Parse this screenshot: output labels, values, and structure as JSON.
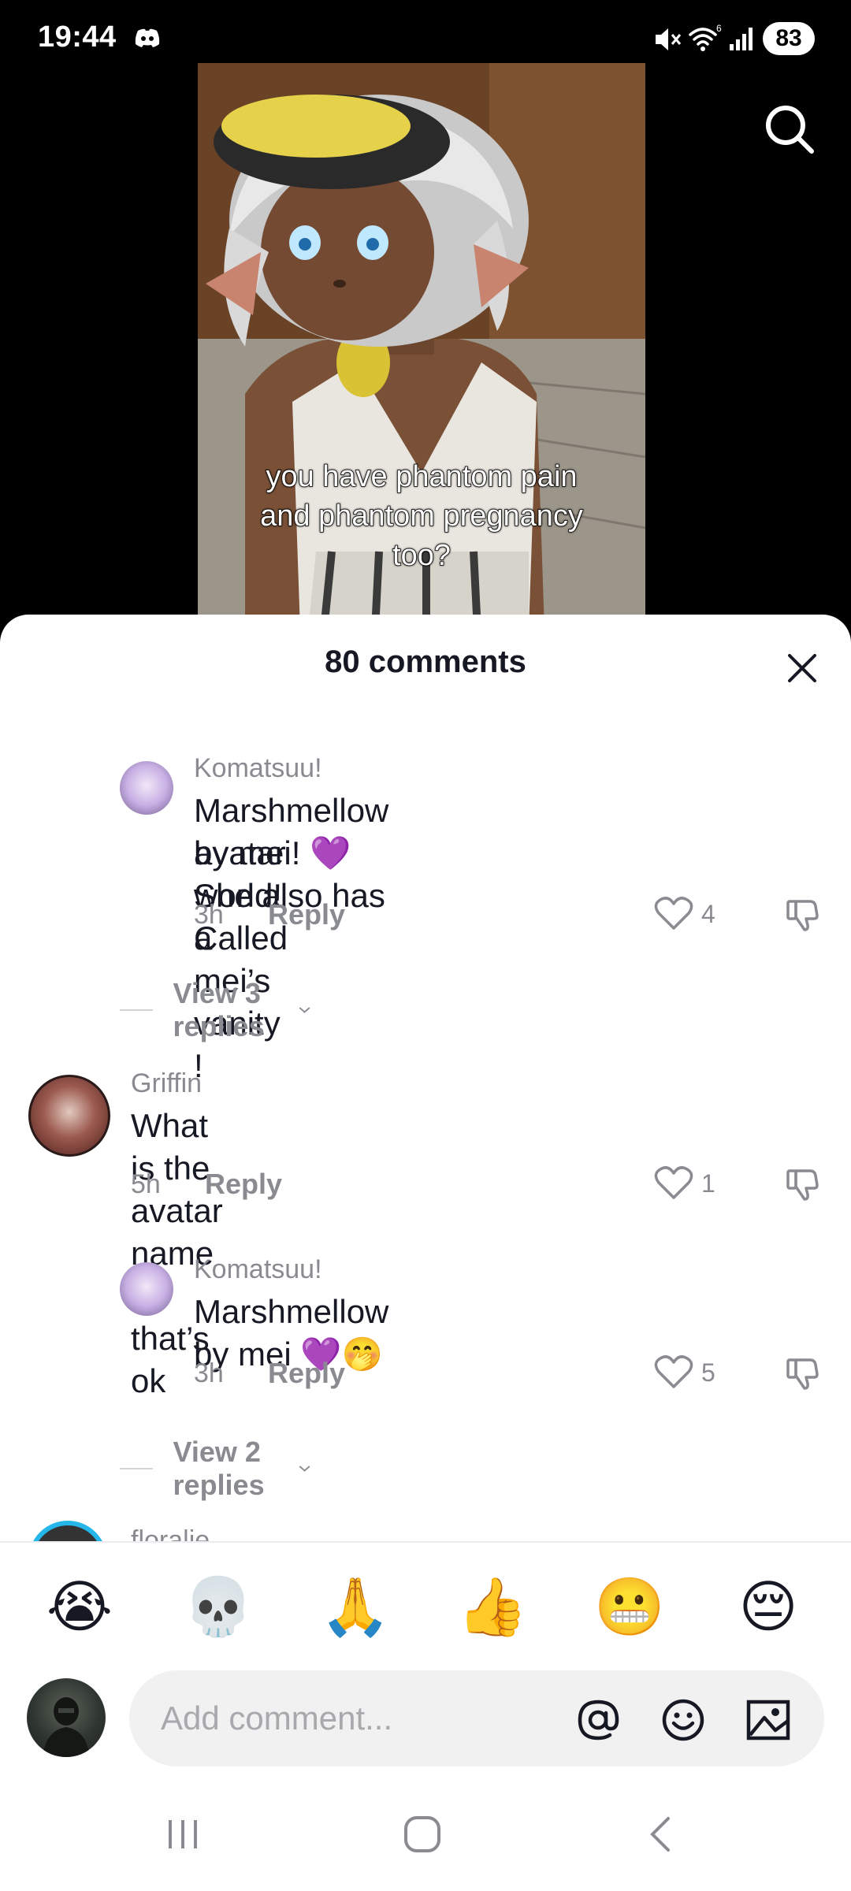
{
  "status_bar": {
    "time": "19:44",
    "battery": "83",
    "icons": [
      "discord-icon",
      "mute-icon",
      "wifi-icon",
      "signal-icon"
    ]
  },
  "video": {
    "caption": "you have phantom pain\nand phantom pregnancy\ntoo?"
  },
  "sheet": {
    "title": "80 comments"
  },
  "comments": [
    {
      "user": "Komatsuu!",
      "text_line1": "Marshmellow by mei! 💜 She also has a",
      "text_line2": "avatar world! Called mei’s vanity !",
      "time": "3h",
      "reply": "Reply",
      "likes": "4",
      "view_replies": "View 3 replies"
    },
    {
      "user": "Griffin",
      "text": "What is the avatar name if that’s ok",
      "time": "5h",
      "reply": "Reply",
      "likes": "1"
    },
    {
      "user": "Komatsuu!",
      "text": "Marshmellow by mei 💜🤭",
      "time": "3h",
      "reply": "Reply",
      "likes": "5",
      "view_replies": "View 2 replies"
    }
  ],
  "partial_comment": {
    "user": "floralie"
  },
  "emoji_bar": [
    "😭",
    "💀",
    "🙏",
    "👍",
    "😬",
    "😔"
  ],
  "composer": {
    "placeholder": "Add comment..."
  },
  "colors": {
    "accent_purple": "#a64dde",
    "text_primary": "#161823",
    "text_secondary": "#8a8b91",
    "input_bg": "#f1f1f2"
  }
}
